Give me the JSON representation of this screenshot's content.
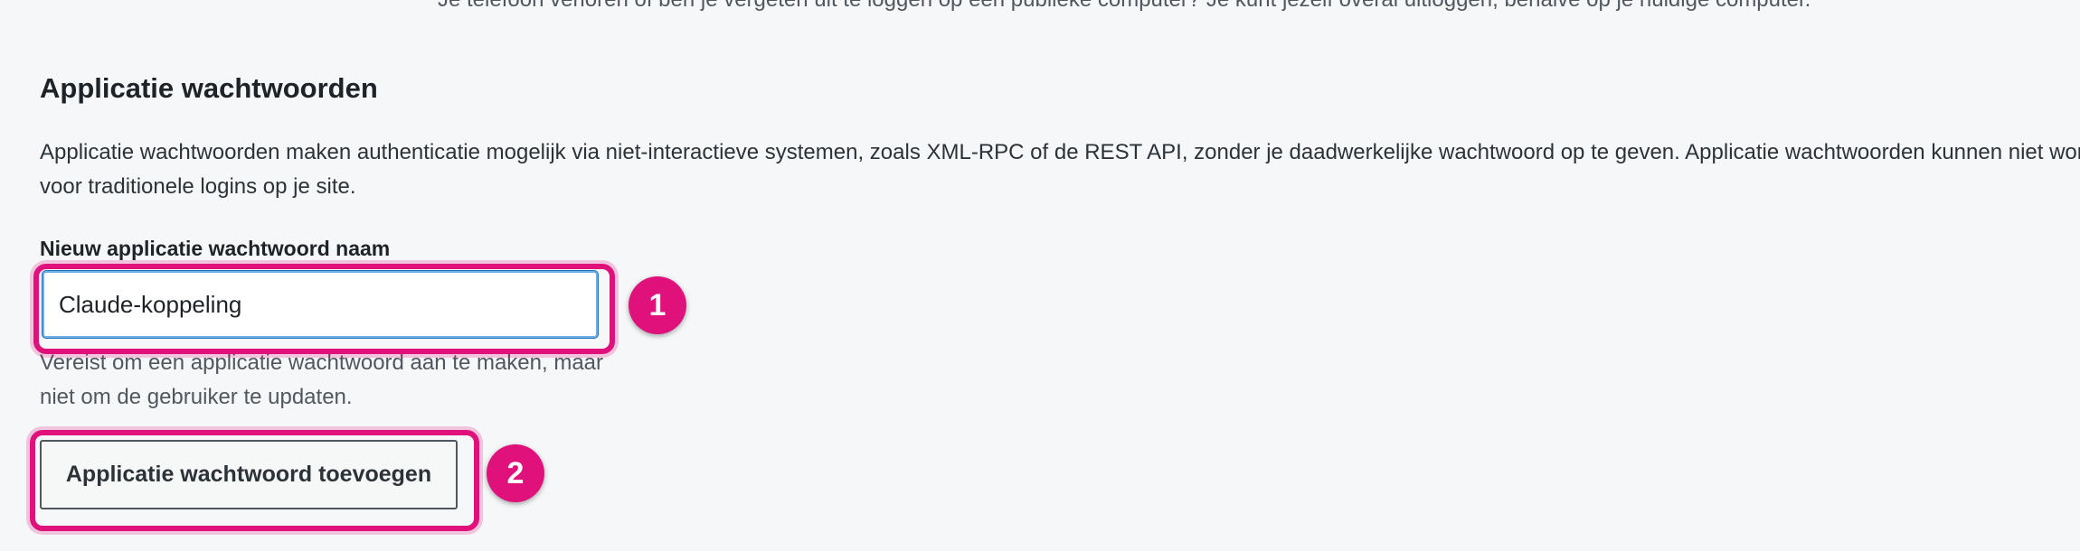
{
  "top_note": "Je telefoon verloren of ben je vergeten uit te loggen op een publieke computer? Je kunt jezelf overal uitloggen, behalve op je huidige computer.",
  "section": {
    "title": "Applicatie wachtwoorden",
    "description": "Applicatie wachtwoorden maken authenticatie mogelijk via niet-interactieve systemen, zoals XML-RPC of de REST API, zonder je daadwerkelijke wachtwoord op te geven. Applicatie wachtwoorden kunnen niet worden gebruikt voor traditionele logins op je site."
  },
  "form": {
    "label": "Nieuw applicatie wachtwoord naam",
    "input_value": "Claude-koppeling",
    "help_text": "Vereist om een applicatie wachtwoord aan te maken, maar niet om de gebruiker te updaten.",
    "button_label": "Applicatie wachtwoord toevoegen"
  },
  "annotations": {
    "marker_1": "1",
    "marker_2": "2",
    "highlight_color": "#e0117a"
  }
}
